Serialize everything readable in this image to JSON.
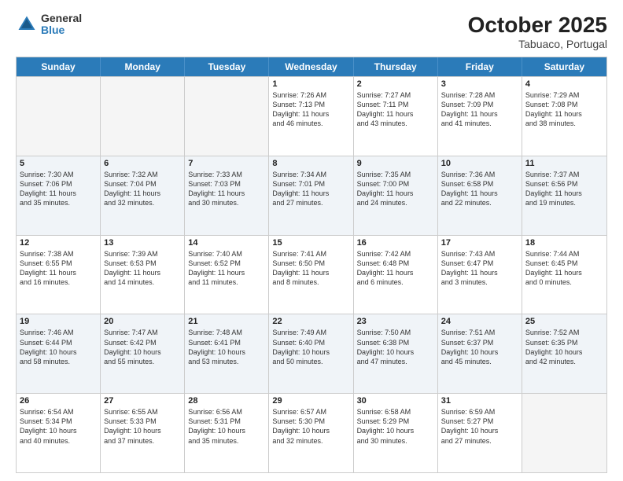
{
  "header": {
    "logo_general": "General",
    "logo_blue": "Blue",
    "month": "October 2025",
    "location": "Tabuaco, Portugal"
  },
  "weekdays": [
    "Sunday",
    "Monday",
    "Tuesday",
    "Wednesday",
    "Thursday",
    "Friday",
    "Saturday"
  ],
  "rows": [
    [
      {
        "day": "",
        "info": ""
      },
      {
        "day": "",
        "info": ""
      },
      {
        "day": "",
        "info": ""
      },
      {
        "day": "1",
        "info": "Sunrise: 7:26 AM\nSunset: 7:13 PM\nDaylight: 11 hours\nand 46 minutes."
      },
      {
        "day": "2",
        "info": "Sunrise: 7:27 AM\nSunset: 7:11 PM\nDaylight: 11 hours\nand 43 minutes."
      },
      {
        "day": "3",
        "info": "Sunrise: 7:28 AM\nSunset: 7:09 PM\nDaylight: 11 hours\nand 41 minutes."
      },
      {
        "day": "4",
        "info": "Sunrise: 7:29 AM\nSunset: 7:08 PM\nDaylight: 11 hours\nand 38 minutes."
      }
    ],
    [
      {
        "day": "5",
        "info": "Sunrise: 7:30 AM\nSunset: 7:06 PM\nDaylight: 11 hours\nand 35 minutes."
      },
      {
        "day": "6",
        "info": "Sunrise: 7:32 AM\nSunset: 7:04 PM\nDaylight: 11 hours\nand 32 minutes."
      },
      {
        "day": "7",
        "info": "Sunrise: 7:33 AM\nSunset: 7:03 PM\nDaylight: 11 hours\nand 30 minutes."
      },
      {
        "day": "8",
        "info": "Sunrise: 7:34 AM\nSunset: 7:01 PM\nDaylight: 11 hours\nand 27 minutes."
      },
      {
        "day": "9",
        "info": "Sunrise: 7:35 AM\nSunset: 7:00 PM\nDaylight: 11 hours\nand 24 minutes."
      },
      {
        "day": "10",
        "info": "Sunrise: 7:36 AM\nSunset: 6:58 PM\nDaylight: 11 hours\nand 22 minutes."
      },
      {
        "day": "11",
        "info": "Sunrise: 7:37 AM\nSunset: 6:56 PM\nDaylight: 11 hours\nand 19 minutes."
      }
    ],
    [
      {
        "day": "12",
        "info": "Sunrise: 7:38 AM\nSunset: 6:55 PM\nDaylight: 11 hours\nand 16 minutes."
      },
      {
        "day": "13",
        "info": "Sunrise: 7:39 AM\nSunset: 6:53 PM\nDaylight: 11 hours\nand 14 minutes."
      },
      {
        "day": "14",
        "info": "Sunrise: 7:40 AM\nSunset: 6:52 PM\nDaylight: 11 hours\nand 11 minutes."
      },
      {
        "day": "15",
        "info": "Sunrise: 7:41 AM\nSunset: 6:50 PM\nDaylight: 11 hours\nand 8 minutes."
      },
      {
        "day": "16",
        "info": "Sunrise: 7:42 AM\nSunset: 6:48 PM\nDaylight: 11 hours\nand 6 minutes."
      },
      {
        "day": "17",
        "info": "Sunrise: 7:43 AM\nSunset: 6:47 PM\nDaylight: 11 hours\nand 3 minutes."
      },
      {
        "day": "18",
        "info": "Sunrise: 7:44 AM\nSunset: 6:45 PM\nDaylight: 11 hours\nand 0 minutes."
      }
    ],
    [
      {
        "day": "19",
        "info": "Sunrise: 7:46 AM\nSunset: 6:44 PM\nDaylight: 10 hours\nand 58 minutes."
      },
      {
        "day": "20",
        "info": "Sunrise: 7:47 AM\nSunset: 6:42 PM\nDaylight: 10 hours\nand 55 minutes."
      },
      {
        "day": "21",
        "info": "Sunrise: 7:48 AM\nSunset: 6:41 PM\nDaylight: 10 hours\nand 53 minutes."
      },
      {
        "day": "22",
        "info": "Sunrise: 7:49 AM\nSunset: 6:40 PM\nDaylight: 10 hours\nand 50 minutes."
      },
      {
        "day": "23",
        "info": "Sunrise: 7:50 AM\nSunset: 6:38 PM\nDaylight: 10 hours\nand 47 minutes."
      },
      {
        "day": "24",
        "info": "Sunrise: 7:51 AM\nSunset: 6:37 PM\nDaylight: 10 hours\nand 45 minutes."
      },
      {
        "day": "25",
        "info": "Sunrise: 7:52 AM\nSunset: 6:35 PM\nDaylight: 10 hours\nand 42 minutes."
      }
    ],
    [
      {
        "day": "26",
        "info": "Sunrise: 6:54 AM\nSunset: 5:34 PM\nDaylight: 10 hours\nand 40 minutes."
      },
      {
        "day": "27",
        "info": "Sunrise: 6:55 AM\nSunset: 5:33 PM\nDaylight: 10 hours\nand 37 minutes."
      },
      {
        "day": "28",
        "info": "Sunrise: 6:56 AM\nSunset: 5:31 PM\nDaylight: 10 hours\nand 35 minutes."
      },
      {
        "day": "29",
        "info": "Sunrise: 6:57 AM\nSunset: 5:30 PM\nDaylight: 10 hours\nand 32 minutes."
      },
      {
        "day": "30",
        "info": "Sunrise: 6:58 AM\nSunset: 5:29 PM\nDaylight: 10 hours\nand 30 minutes."
      },
      {
        "day": "31",
        "info": "Sunrise: 6:59 AM\nSunset: 5:27 PM\nDaylight: 10 hours\nand 27 minutes."
      },
      {
        "day": "",
        "info": ""
      }
    ]
  ]
}
